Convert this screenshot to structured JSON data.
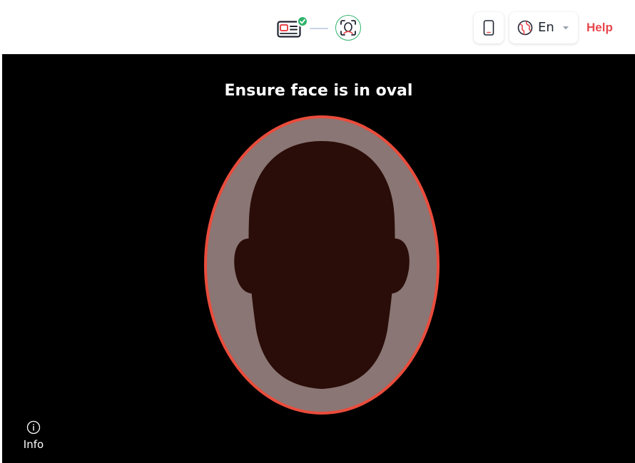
{
  "header": {
    "steps": [
      {
        "icon": "id-card-icon",
        "status": "completed"
      },
      {
        "icon": "face-scan-icon",
        "status": "active"
      }
    ],
    "device_icon": "smartphone-icon",
    "language": {
      "icon": "globe-icon",
      "code": "En"
    },
    "help_label": "Help"
  },
  "camera": {
    "instruction": "Ensure face is in oval",
    "info_label": "Info",
    "info_icon": "info-circle-icon"
  },
  "colors": {
    "accent": "#e8474d",
    "success": "#2fb36b",
    "oval_border": "#ea4c3c",
    "oval_fill": "#8a7674",
    "face_silhouette": "#2a0d08",
    "camera_background": "#000000"
  }
}
